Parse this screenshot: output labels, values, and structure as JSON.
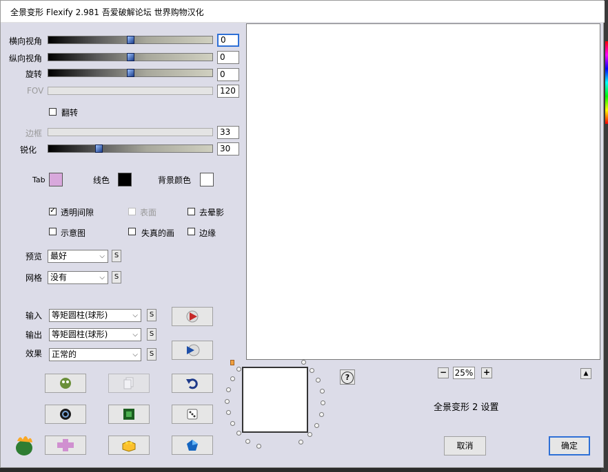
{
  "window": {
    "title": "全景变形 Flexify 2.981 吾爱破解论坛 世界购物汉化"
  },
  "sliders": [
    {
      "label": "横向视角",
      "value": "0",
      "level": 0.5,
      "disabled": false,
      "focused": true
    },
    {
      "label": "纵向视角",
      "value": "0",
      "level": 0.5,
      "disabled": false,
      "focused": false
    },
    {
      "label": "旋转",
      "value": "0",
      "level": 0.5,
      "disabled": false,
      "focused": false
    },
    {
      "label": "FOV",
      "value": "120",
      "level": null,
      "disabled": true,
      "focused": false
    },
    {
      "label": "边框",
      "value": "33",
      "level": null,
      "disabled": true,
      "focused": false
    },
    {
      "label": "锐化",
      "value": "30",
      "level": 0.3,
      "disabled": false,
      "focused": false
    }
  ],
  "flip": {
    "label": "翻转",
    "checked": false
  },
  "colors": {
    "tab_label": "Tab",
    "tab_color": "#d8a8dc",
    "line_label": "线色",
    "line_color": "#000000",
    "bg_label": "背景颜色",
    "bg_color": "#ffffff"
  },
  "options": {
    "transparent_gap": {
      "label": "透明间隙",
      "checked": true
    },
    "surface": {
      "label": "表面",
      "checked": false,
      "disabled": true
    },
    "remove_halo": {
      "label": "去晕影",
      "checked": false
    },
    "schematic": {
      "label": "示意图",
      "checked": false
    },
    "distortion": {
      "label": "失真的画",
      "checked": false
    },
    "edge": {
      "label": "边缘",
      "checked": false
    }
  },
  "preview_quality": {
    "label": "预览",
    "value": "最好",
    "s": "S"
  },
  "grid": {
    "label": "网格",
    "value": "没有",
    "s": "S"
  },
  "input": {
    "label": "输入",
    "value": "等矩圆柱(球形)",
    "s": "S"
  },
  "output": {
    "label": "输出",
    "value": "等矩圆柱(球形)",
    "s": "S"
  },
  "effect": {
    "label": "效果",
    "value": "正常的",
    "s": "S"
  },
  "zoom": {
    "minus": "−",
    "value": "25%",
    "plus": "+"
  },
  "help": "?",
  "settings_title": "全景变形 2 设置",
  "buttons": {
    "cancel": "取消",
    "ok": "确定",
    "collapse": "▲"
  }
}
